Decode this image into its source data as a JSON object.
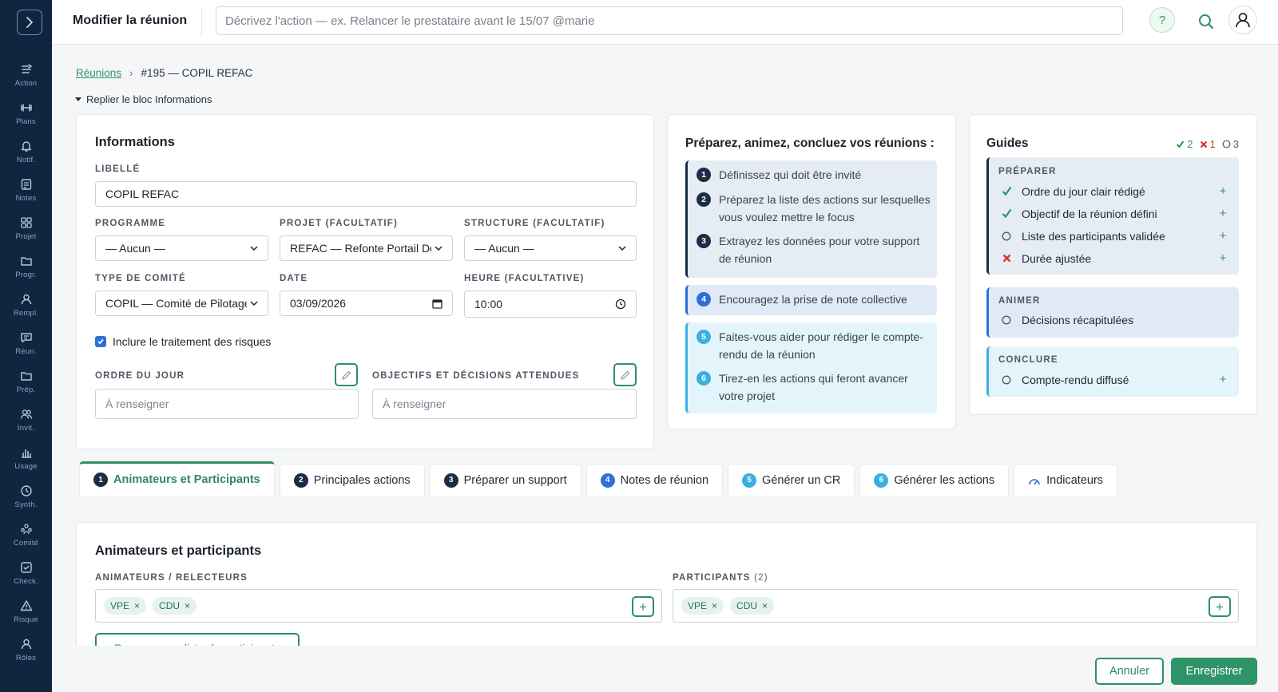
{
  "sidebar": {
    "items": [
      {
        "label": "Action",
        "icon": "action-icon"
      },
      {
        "label": "Plans",
        "icon": "plans-icon"
      },
      {
        "label": "Notif.",
        "icon": "bell-icon"
      },
      {
        "label": "Notes",
        "icon": "notes-icon"
      },
      {
        "label": "Projet",
        "icon": "grid-icon"
      },
      {
        "label": "Progr.",
        "icon": "folder-icon"
      },
      {
        "label": "Rempl.",
        "icon": "person-icon"
      },
      {
        "label": "Réun.",
        "icon": "chat-icon"
      },
      {
        "label": "Prép.",
        "icon": "folder-icon"
      },
      {
        "label": "Invit.",
        "icon": "people-icon"
      },
      {
        "label": "Usage",
        "icon": "bar-chart-icon"
      },
      {
        "label": "Synth.",
        "icon": "clock-icon"
      },
      {
        "label": "Comité",
        "icon": "committee-icon"
      },
      {
        "label": "Check.",
        "icon": "checkbox-icon"
      },
      {
        "label": "Risque",
        "icon": "warning-icon"
      },
      {
        "label": "Rôles",
        "icon": "person-icon"
      }
    ]
  },
  "topbar": {
    "title": "Modifier la réunion",
    "search_placeholder": "Décrivez l'action — ex. Relancer le prestataire avant le 15/07 @marie",
    "help_label": "?"
  },
  "breadcrumb": {
    "parent": "Réunions",
    "separator": "›",
    "current": "#195 — COPIL REFAC"
  },
  "collapse_label": "Replier le bloc Informations",
  "info": {
    "title": "Informations",
    "libelle_label": "LIBELLÉ",
    "libelle_value": "COPIL REFAC",
    "programme_label": "PROGRAMME",
    "programme_value": "— Aucun —",
    "projet_label": "PROJET (FACULTATIF)",
    "projet_value": "REFAC — Refonte Portail Doc",
    "structure_label": "STRUCTURE (FACULTATIF)",
    "structure_value": "— Aucun —",
    "comite_label": "TYPE DE COMITÉ",
    "comite_value": "COPIL — Comité de Pilotage",
    "date_label": "DATE",
    "date_value": "03/09/2026",
    "heure_label": "HEURE (FACULTATIVE)",
    "heure_value": "10:00",
    "risques_label": "Inclure le traitement des risques",
    "risques_checked": true,
    "ordre_label": "ORDRE DU JOUR",
    "ordre_placeholder": "À renseigner",
    "objectifs_label": "OBJECTIFS ET DÉCISIONS ATTENDUES",
    "objectifs_placeholder": "À renseigner"
  },
  "prep": {
    "title": "Préparez, animez, concluez vos réunions :",
    "steps": [
      {
        "num": "1",
        "text": "Définissez qui doit être invité"
      },
      {
        "num": "2",
        "text": "Préparez la liste des actions sur lesquelles vous voulez mettre le focus"
      },
      {
        "num": "3",
        "text": "Extrayez les données pour votre support de réunion"
      },
      {
        "num": "4",
        "text": "Encouragez la prise de note collective"
      },
      {
        "num": "5",
        "text": "Faites-vous aider pour rédiger le compte-rendu de la réunion"
      },
      {
        "num": "6",
        "text": "Tirez-en les actions qui feront avancer votre projet"
      }
    ]
  },
  "guides": {
    "title": "Guides",
    "stats": {
      "done": "2",
      "failed": "1",
      "pending": "3"
    },
    "sections": [
      {
        "title": "PRÉPARER",
        "items": [
          {
            "text": "Ordre du jour clair rédigé",
            "status": "done"
          },
          {
            "text": "Objectif de la réunion défini",
            "status": "done"
          },
          {
            "text": "Liste des participants validée",
            "status": "pending"
          },
          {
            "text": "Durée ajustée",
            "status": "failed"
          }
        ]
      },
      {
        "title": "ANIMER",
        "items": [
          {
            "text": "Décisions récapitulées",
            "status": "pending"
          }
        ]
      },
      {
        "title": "CONCLURE",
        "items": [
          {
            "text": "Compte-rendu diffusé",
            "status": "pending"
          }
        ]
      }
    ]
  },
  "tabs": [
    {
      "num": "1",
      "label": "Animateurs et Participants"
    },
    {
      "num": "2",
      "label": "Principales actions"
    },
    {
      "num": "3",
      "label": "Préparer un support"
    },
    {
      "num": "4",
      "label": "Notes de réunion"
    },
    {
      "num": "5",
      "label": "Générer un CR"
    },
    {
      "num": "6",
      "label": "Générer les actions"
    },
    {
      "num": "",
      "label": "Indicateurs"
    }
  ],
  "participants": {
    "title": "Animateurs et participants",
    "animateurs_label": "ANIMATEURS / RELECTEURS",
    "animateurs": [
      "VPE",
      "CDU"
    ],
    "participants_label": "PARTICIPANTS",
    "participants_count": "(2)",
    "participants": [
      "VPE",
      "CDU"
    ],
    "propose_label": "Proposer une liste de participants",
    "tag_remove": "×",
    "add_label": "+"
  },
  "actions": {
    "cancel": "Annuler",
    "save": "Enregistrer"
  },
  "colors": {
    "accent": "#2e9467",
    "sidebar": "#0f2540",
    "dark_step": "#1b2d45",
    "blue_step": "#2f6fd8",
    "light_step": "#3ab0e0",
    "fail": "#d9302c"
  }
}
